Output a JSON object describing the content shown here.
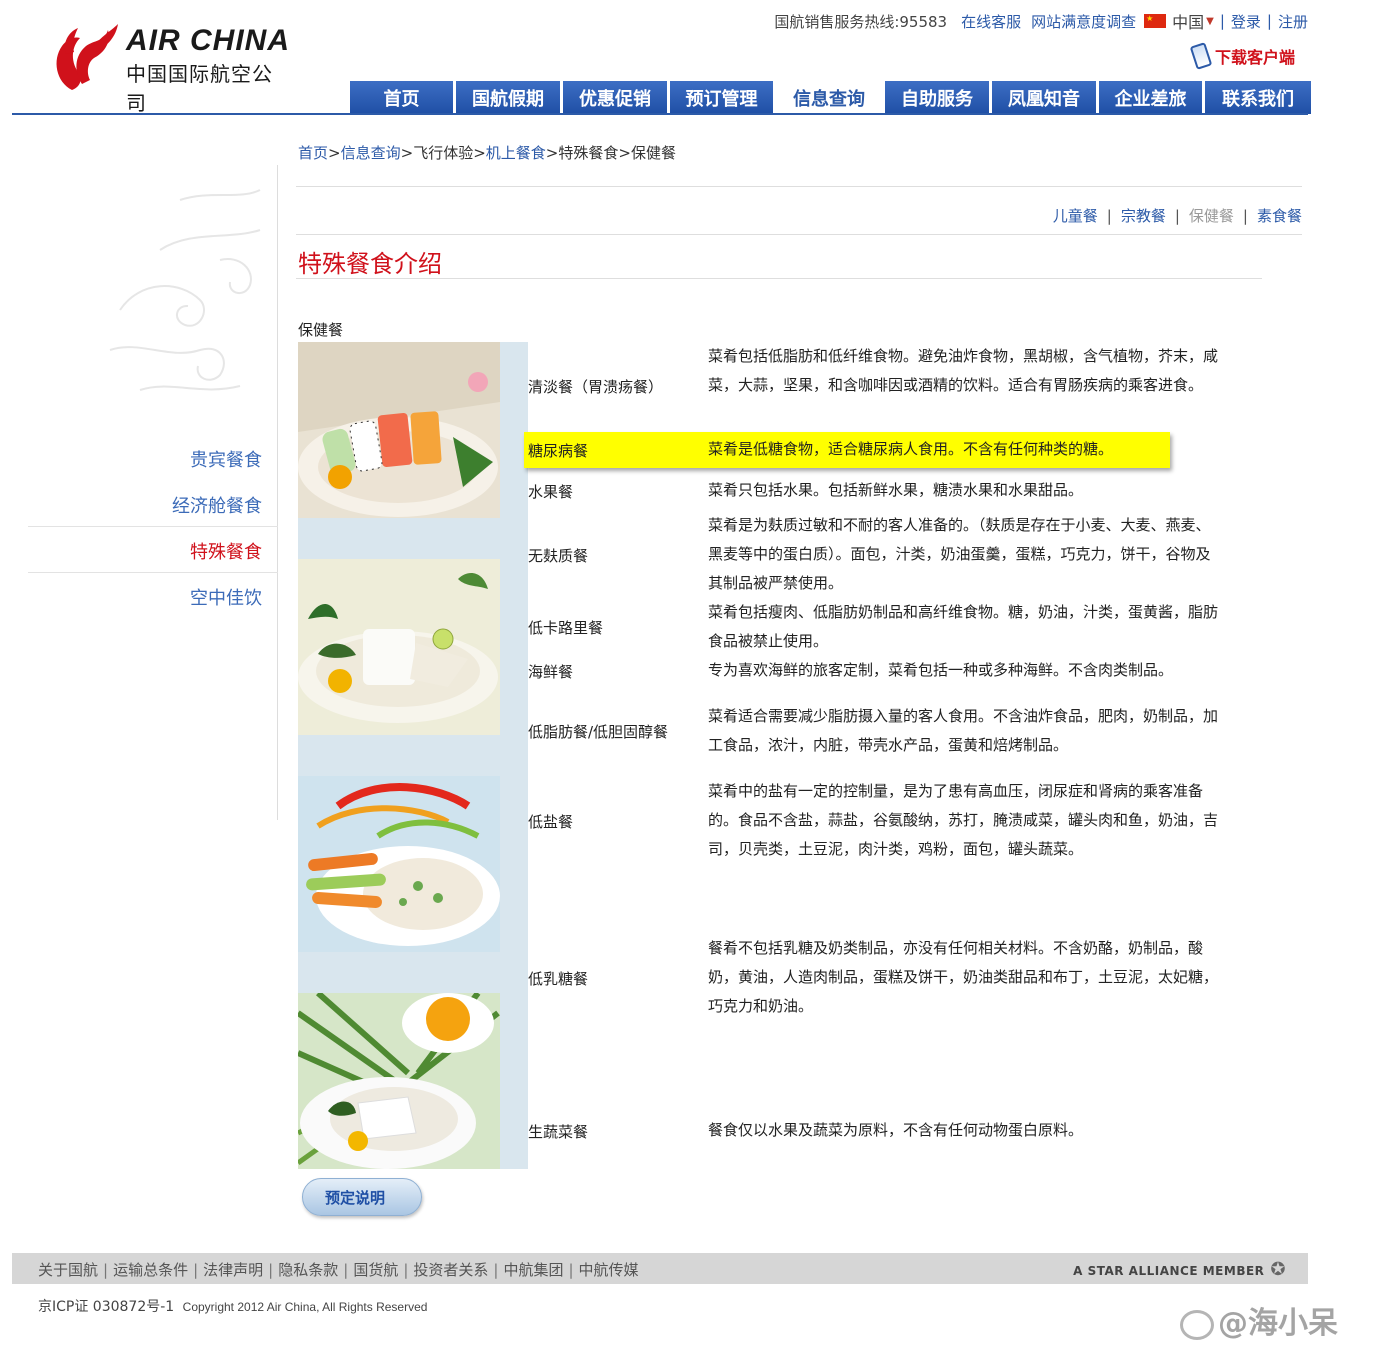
{
  "header": {
    "logo_en": "AIR CHINA",
    "logo_cn": "中国国际航空公司",
    "hotline": "国航销售服务热线:95583",
    "links": [
      "在线客服",
      "网站满意度调查"
    ],
    "language": "中国",
    "login": "登录",
    "register": "注册",
    "download": "下载客户端",
    "nav": [
      {
        "label": "首页",
        "active": false
      },
      {
        "label": "国航假期",
        "active": false
      },
      {
        "label": "优惠促销",
        "active": false
      },
      {
        "label": "预订管理",
        "active": false
      },
      {
        "label": "信息查询",
        "active": true
      },
      {
        "label": "自助服务",
        "active": false
      },
      {
        "label": "凤凰知音",
        "active": false
      },
      {
        "label": "企业差旅",
        "active": false
      },
      {
        "label": "联系我们",
        "active": false
      }
    ]
  },
  "sidebar": {
    "items": [
      {
        "label": "贵宾餐食",
        "active": false
      },
      {
        "label": "经济舱餐食",
        "active": false
      },
      {
        "label": "特殊餐食",
        "active": true
      },
      {
        "label": "空中佳饮",
        "active": false
      }
    ]
  },
  "breadcrumb": [
    {
      "label": "首页",
      "link": true
    },
    {
      "label": "信息查询",
      "link": true
    },
    {
      "label": "飞行体验",
      "link": false
    },
    {
      "label": "机上餐食",
      "link": true
    },
    {
      "label": "特殊餐食",
      "link": false
    },
    {
      "label": "保健餐",
      "link": false
    }
  ],
  "subnav": [
    {
      "label": "儿童餐",
      "current": false
    },
    {
      "label": "宗教餐",
      "current": false
    },
    {
      "label": "保健餐",
      "current": true
    },
    {
      "label": "素食餐",
      "current": false
    }
  ],
  "main": {
    "title": "特殊餐食介绍",
    "category": "保健餐",
    "meals": [
      {
        "name": "清淡餐（胃溃疡餐）",
        "desc": "菜肴包括低脂肪和低纤维食物。避免油炸食物，黑胡椒，含气植物，芥末，咸菜，大蒜，坚果，和含咖啡因或酒精的饮料。适合有胃肠疾病的乘客进食。"
      },
      {
        "name": "糖尿病餐",
        "desc": "菜肴是低糖食物，适合糖尿病人食用。不含有任何种类的糖。"
      },
      {
        "name": "水果餐",
        "desc": "菜肴只包括水果。包括新鲜水果，糖渍水果和水果甜品。"
      },
      {
        "name": "无麸质餐",
        "desc": "菜肴是为麸质过敏和不耐的客人准备的。（麸质是存在于小麦、大麦、燕麦、黑麦等中的蛋白质）。面包，汁类，奶油蛋羹，蛋糕，巧克力，饼干，谷物及其制品被严禁使用。"
      },
      {
        "name": "低卡路里餐",
        "desc": "菜肴包括瘦肉、低脂肪奶制品和高纤维食物。糖，奶油，汁类，蛋黄酱，脂肪食品被禁止使用。"
      },
      {
        "name": "海鲜餐",
        "desc": "专为喜欢海鲜的旅客定制，菜肴包括一种或多种海鲜。不含肉类制品。"
      },
      {
        "name": "低脂肪餐/低胆固醇餐",
        "desc": "菜肴适合需要减少脂肪摄入量的客人食用。不含油炸食品，肥肉，奶制品，加工食品，浓汁，内脏，带壳水产品，蛋黄和焙烤制品。"
      },
      {
        "name": "低盐餐",
        "desc": "菜肴中的盐有一定的控制量，是为了患有高血压，闭尿症和肾病的乘客准备的。食品不含盐，蒜盐，谷氨酸纳，苏打，腌渍咸菜，罐头肉和鱼，奶油，吉司，贝壳类，土豆泥，肉汁类，鸡粉，面包，罐头蔬菜。"
      },
      {
        "name": "低乳糖餐",
        "desc": "餐肴不包括乳糖及奶类制品，亦没有任何相关材料。不含奶酪，奶制品，酸奶，黄油，人造肉制品，蛋糕及饼干，奶油类甜品和布丁，土豆泥，太妃糖，巧克力和奶油。"
      },
      {
        "name": "生蔬菜餐",
        "desc": "餐食仅以水果及蔬菜为原料，不含有任何动物蛋白原料。"
      }
    ],
    "book_button": "预定说明"
  },
  "footer": {
    "links": [
      "关于国航",
      "运输总条件",
      "法律声明",
      "隐私条款",
      "国货航",
      "投资者关系",
      "中航集团",
      "中航传媒"
    ],
    "star_alliance": "A STAR ALLIANCE MEMBER",
    "icp": "京ICP证 030872号-1",
    "copyright": "Copyright 2012 Air China, All Rights Reserved",
    "watermark": "@海小呆"
  },
  "colors": {
    "brand_blue": "#2c5aa8",
    "brand_red": "#d0111b",
    "highlight": "#ffff00",
    "photo_column": "#d9e6ee"
  }
}
